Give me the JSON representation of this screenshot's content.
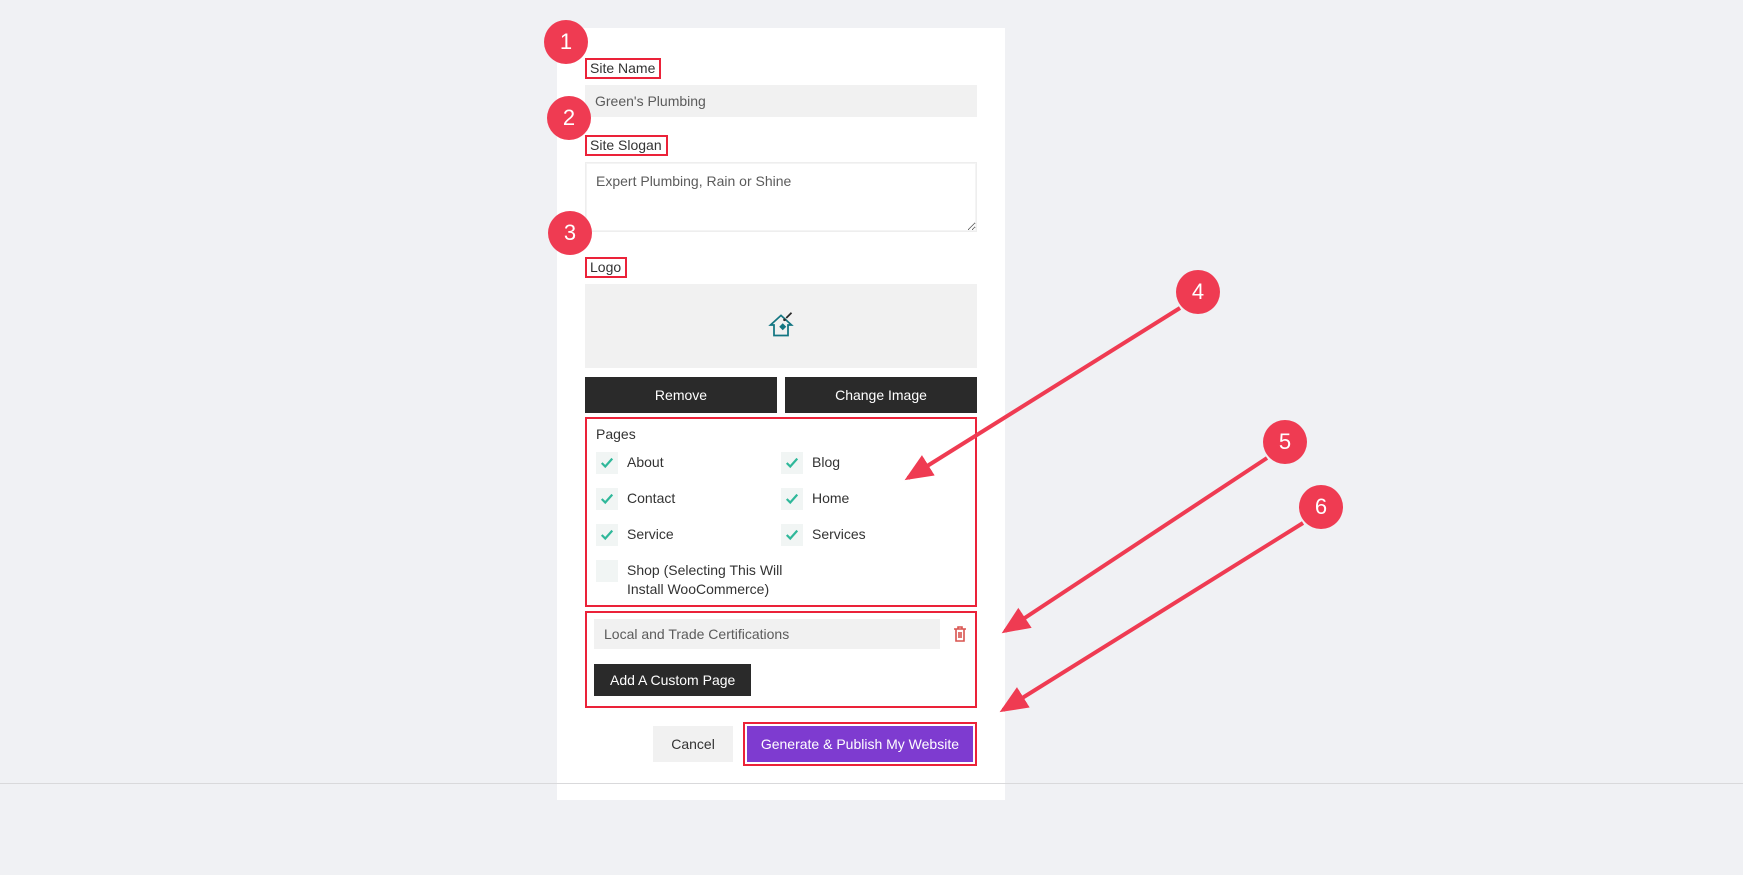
{
  "markers": {
    "m1": "1",
    "m2": "2",
    "m3": "3",
    "m4": "4",
    "m5": "5",
    "m6": "6"
  },
  "form": {
    "site_name": {
      "label": "Site Name",
      "value": "Green's Plumbing"
    },
    "site_slogan": {
      "label": "Site Slogan",
      "value": "Expert Plumbing, Rain or Shine"
    },
    "logo": {
      "label": "Logo",
      "remove_btn": "Remove",
      "change_btn": "Change Image"
    },
    "pages": {
      "title": "Pages",
      "items": [
        {
          "label": "About",
          "checked": true
        },
        {
          "label": "Blog",
          "checked": true
        },
        {
          "label": "Contact",
          "checked": true
        },
        {
          "label": "Home",
          "checked": true
        },
        {
          "label": "Service",
          "checked": true
        },
        {
          "label": "Services",
          "checked": true
        },
        {
          "label": "Shop (Selecting This Will Install WooCommerce)",
          "checked": false
        }
      ]
    },
    "custom_page": {
      "value": "Local and Trade Certifications",
      "add_btn": "Add A Custom Page"
    },
    "footer": {
      "cancel": "Cancel",
      "publish": "Generate & Publish My Website"
    }
  }
}
